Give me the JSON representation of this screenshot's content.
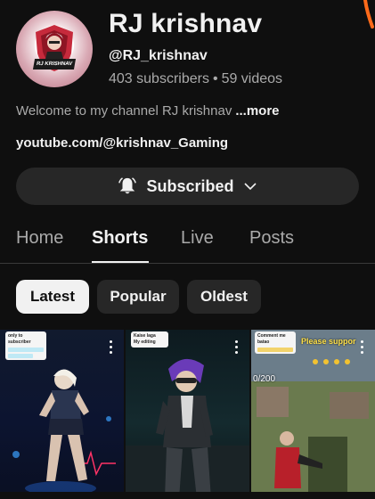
{
  "channel": {
    "name": "RJ krishnav",
    "handle": "@RJ_krishnav",
    "subscribers": "403 subscribers",
    "separator": "•",
    "videos": "59 videos",
    "avatar_tag": "RJ KRISHNAV",
    "description": "Welcome to my channel RJ krishnav",
    "more_label": "...more",
    "link": "youtube.com/@krishnav_Gaming"
  },
  "subscribe_button": {
    "label": "Subscribed",
    "icon": "bell-icon",
    "chevron": "chevron-down-icon"
  },
  "tabs": [
    {
      "label": "Home",
      "active": false
    },
    {
      "label": "Shorts",
      "active": true
    },
    {
      "label": "Live",
      "active": false
    },
    {
      "label": "Posts",
      "active": false
    }
  ],
  "filters": [
    {
      "label": "Latest",
      "active": true
    },
    {
      "label": "Popular",
      "active": false
    },
    {
      "label": "Oldest",
      "active": false
    }
  ],
  "shorts": [
    {
      "note_title": "only to subscriber"
    },
    {
      "note_title": "Kaise laga",
      "note_line2": "My editing"
    },
    {
      "note_title": "Comment me batao",
      "overlay_text": "Please suppor",
      "score_text": "0/200"
    }
  ],
  "colors": {
    "background": "#0f0f0f",
    "chip_bg": "#272727",
    "active_chip_bg": "#f1f1f1",
    "secondary_text": "#aaaaaa",
    "avatar_red": "#c62a3c"
  }
}
